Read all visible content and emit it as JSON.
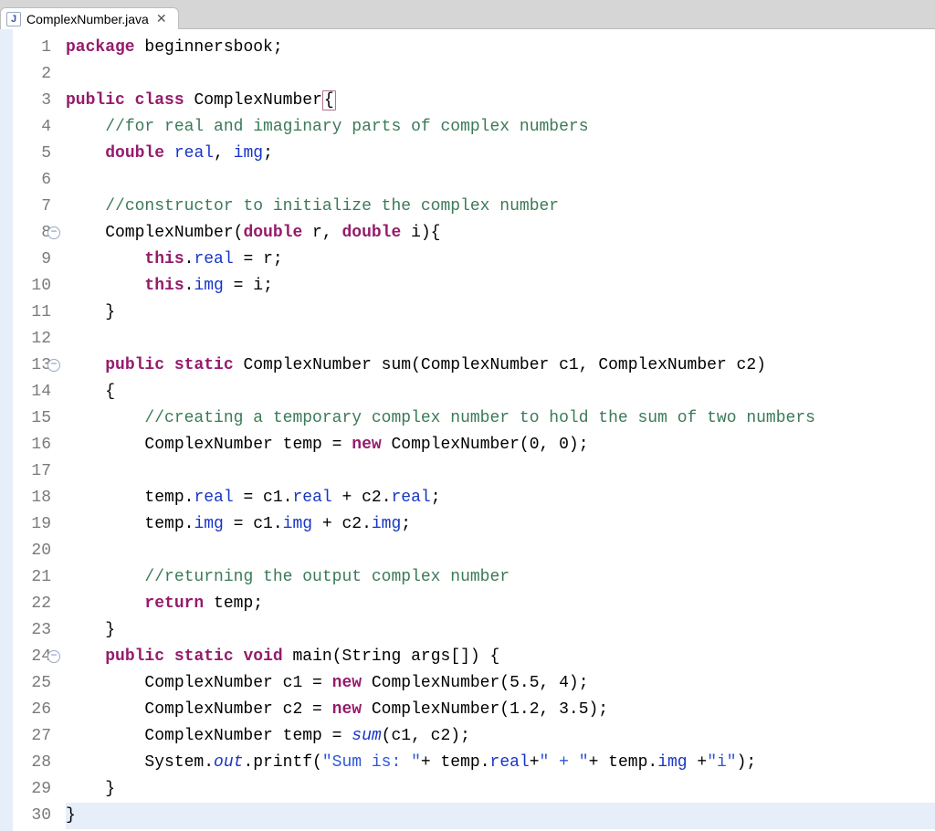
{
  "tab": {
    "filename": "ComplexNumber.java",
    "icon_letter": "J",
    "close_glyph": "✕"
  },
  "gutter": {
    "line_count": 30,
    "fold_markers": [
      8,
      13,
      24
    ],
    "fold_glyph": "−"
  },
  "code": {
    "lines": [
      {
        "n": 1,
        "tokens": [
          {
            "t": "package",
            "c": "kw"
          },
          {
            "t": " beginnersbook;",
            "c": ""
          }
        ]
      },
      {
        "n": 2,
        "tokens": []
      },
      {
        "n": 3,
        "tokens": [
          {
            "t": "public",
            "c": "kw"
          },
          {
            "t": " ",
            "c": ""
          },
          {
            "t": "class",
            "c": "kw"
          },
          {
            "t": " ComplexNumber",
            "c": ""
          },
          {
            "t": "{",
            "c": "class-hl"
          }
        ]
      },
      {
        "n": 4,
        "tokens": [
          {
            "t": "    ",
            "c": ""
          },
          {
            "t": "//for real and imaginary parts of complex numbers",
            "c": "comment"
          }
        ]
      },
      {
        "n": 5,
        "tokens": [
          {
            "t": "    ",
            "c": ""
          },
          {
            "t": "double",
            "c": "kw"
          },
          {
            "t": " ",
            "c": ""
          },
          {
            "t": "real",
            "c": "field"
          },
          {
            "t": ", ",
            "c": ""
          },
          {
            "t": "img",
            "c": "field"
          },
          {
            "t": ";",
            "c": ""
          }
        ]
      },
      {
        "n": 6,
        "tokens": []
      },
      {
        "n": 7,
        "tokens": [
          {
            "t": "    ",
            "c": ""
          },
          {
            "t": "//constructor to initialize the complex number",
            "c": "comment"
          }
        ]
      },
      {
        "n": 8,
        "tokens": [
          {
            "t": "    ComplexNumber(",
            "c": ""
          },
          {
            "t": "double",
            "c": "kw"
          },
          {
            "t": " r, ",
            "c": ""
          },
          {
            "t": "double",
            "c": "kw"
          },
          {
            "t": " i){",
            "c": ""
          }
        ]
      },
      {
        "n": 9,
        "tokens": [
          {
            "t": "        ",
            "c": ""
          },
          {
            "t": "this",
            "c": "kw"
          },
          {
            "t": ".",
            "c": ""
          },
          {
            "t": "real",
            "c": "field"
          },
          {
            "t": " = r;",
            "c": ""
          }
        ]
      },
      {
        "n": 10,
        "tokens": [
          {
            "t": "        ",
            "c": ""
          },
          {
            "t": "this",
            "c": "kw"
          },
          {
            "t": ".",
            "c": ""
          },
          {
            "t": "img",
            "c": "field"
          },
          {
            "t": " = i;",
            "c": ""
          }
        ]
      },
      {
        "n": 11,
        "tokens": [
          {
            "t": "    }",
            "c": ""
          }
        ]
      },
      {
        "n": 12,
        "tokens": []
      },
      {
        "n": 13,
        "tokens": [
          {
            "t": "    ",
            "c": ""
          },
          {
            "t": "public",
            "c": "kw"
          },
          {
            "t": " ",
            "c": ""
          },
          {
            "t": "static",
            "c": "kw"
          },
          {
            "t": " ComplexNumber sum(ComplexNumber c1, ComplexNumber c2)",
            "c": ""
          }
        ]
      },
      {
        "n": 14,
        "tokens": [
          {
            "t": "    {",
            "c": ""
          }
        ]
      },
      {
        "n": 15,
        "tokens": [
          {
            "t": "        ",
            "c": ""
          },
          {
            "t": "//creating a temporary complex number to hold the sum of two numbers",
            "c": "comment"
          }
        ]
      },
      {
        "n": 16,
        "tokens": [
          {
            "t": "        ComplexNumber temp = ",
            "c": ""
          },
          {
            "t": "new",
            "c": "kw"
          },
          {
            "t": " ComplexNumber(0, 0);",
            "c": ""
          }
        ]
      },
      {
        "n": 17,
        "tokens": []
      },
      {
        "n": 18,
        "tokens": [
          {
            "t": "        temp.",
            "c": ""
          },
          {
            "t": "real",
            "c": "field"
          },
          {
            "t": " = c1.",
            "c": ""
          },
          {
            "t": "real",
            "c": "field"
          },
          {
            "t": " + c2.",
            "c": ""
          },
          {
            "t": "real",
            "c": "field"
          },
          {
            "t": ";",
            "c": ""
          }
        ]
      },
      {
        "n": 19,
        "tokens": [
          {
            "t": "        temp.",
            "c": ""
          },
          {
            "t": "img",
            "c": "field"
          },
          {
            "t": " = c1.",
            "c": ""
          },
          {
            "t": "img",
            "c": "field"
          },
          {
            "t": " + c2.",
            "c": ""
          },
          {
            "t": "img",
            "c": "field"
          },
          {
            "t": ";",
            "c": ""
          }
        ]
      },
      {
        "n": 20,
        "tokens": []
      },
      {
        "n": 21,
        "tokens": [
          {
            "t": "        ",
            "c": ""
          },
          {
            "t": "//returning the output complex number",
            "c": "comment"
          }
        ]
      },
      {
        "n": 22,
        "tokens": [
          {
            "t": "        ",
            "c": ""
          },
          {
            "t": "return",
            "c": "kw"
          },
          {
            "t": " temp;",
            "c": ""
          }
        ]
      },
      {
        "n": 23,
        "tokens": [
          {
            "t": "    }",
            "c": ""
          }
        ]
      },
      {
        "n": 24,
        "tokens": [
          {
            "t": "    ",
            "c": ""
          },
          {
            "t": "public",
            "c": "kw"
          },
          {
            "t": " ",
            "c": ""
          },
          {
            "t": "static",
            "c": "kw"
          },
          {
            "t": " ",
            "c": ""
          },
          {
            "t": "void",
            "c": "kw"
          },
          {
            "t": " main(String args[]) {",
            "c": ""
          }
        ]
      },
      {
        "n": 25,
        "tokens": [
          {
            "t": "        ComplexNumber c1 = ",
            "c": ""
          },
          {
            "t": "new",
            "c": "kw"
          },
          {
            "t": " ComplexNumber(5.5, 4);",
            "c": ""
          }
        ]
      },
      {
        "n": 26,
        "tokens": [
          {
            "t": "        ComplexNumber c2 = ",
            "c": ""
          },
          {
            "t": "new",
            "c": "kw"
          },
          {
            "t": " ComplexNumber(1.2, 3.5);",
            "c": ""
          }
        ]
      },
      {
        "n": 27,
        "tokens": [
          {
            "t": "        ComplexNumber temp = ",
            "c": ""
          },
          {
            "t": "sum",
            "c": "static-it"
          },
          {
            "t": "(c1, c2);",
            "c": ""
          }
        ]
      },
      {
        "n": 28,
        "tokens": [
          {
            "t": "        System.",
            "c": ""
          },
          {
            "t": "out",
            "c": "static-it"
          },
          {
            "t": ".printf(",
            "c": ""
          },
          {
            "t": "\"Sum is: \"",
            "c": "str"
          },
          {
            "t": "+ temp.",
            "c": ""
          },
          {
            "t": "real",
            "c": "field"
          },
          {
            "t": "+",
            "c": ""
          },
          {
            "t": "\" + \"",
            "c": "str"
          },
          {
            "t": "+ temp.",
            "c": ""
          },
          {
            "t": "img",
            "c": "field"
          },
          {
            "t": " +",
            "c": ""
          },
          {
            "t": "\"i\"",
            "c": "str"
          },
          {
            "t": ");",
            "c": ""
          }
        ]
      },
      {
        "n": 29,
        "tokens": [
          {
            "t": "    }",
            "c": ""
          }
        ]
      },
      {
        "n": 30,
        "tokens": [
          {
            "t": "}",
            "c": ""
          }
        ]
      }
    ]
  }
}
